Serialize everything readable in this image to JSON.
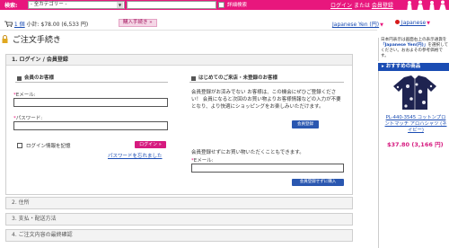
{
  "header": {
    "search_label": "検索:",
    "category_select": "- 全カテゴリー -",
    "advanced_search": "詳細検索",
    "login": "ログイン",
    "or": "または",
    "register": "会員登録"
  },
  "cart": {
    "count": "1 個",
    "subtotal": "小計: $78.00 (6,533 円)",
    "checkout": "購入手続き"
  },
  "locale": {
    "currency": "Japanese Yen (円)",
    "language": "Japanese"
  },
  "page": {
    "title": "ご注文手続き"
  },
  "step1": {
    "title": "1. ログイン / 会員登録",
    "members_heading": "会員のお客様",
    "email_label": "Eメール:",
    "password_label": "パスワード:",
    "remember_label": "ログイン情報を記憶",
    "login_button": "ログイン »",
    "forgot_link": "パスワードを忘れました",
    "new_heading": "はじめてのご来店・未登録のお客様",
    "new_text": "会員登録がお済みでない お客様は、この機会にぜひご登録ください！ 会員になると次回のお買い物よりお客様情報などの入力が不要となり、より快適にショッピングをお楽しみいただけます。",
    "register_button": "会員登録",
    "guest_text": "会員登録せずにお買い物いただくこともできます。",
    "guest_email_label": "Eメール:",
    "guest_button": "会員登録せずに購入"
  },
  "steps": [
    {
      "label": "2. 住所"
    },
    {
      "label": "3. 支払・配送方法"
    },
    {
      "label": "4. ご注文内容の最終確認"
    }
  ],
  "sidebar": {
    "note_prefix": "日本円表示は画面右上の表示通貨を",
    "note_highlight": "「Japanese Yen(円)」",
    "note_suffix": "を選択してください。おおよその参考価格です。",
    "heading": "おすすめの商品",
    "product_name": "PL-440-3545 コットンプロントマッチ アロハシャツ (ネイビー)",
    "product_price": "$37.80 (3,166 円)"
  },
  "colors": {
    "brand_pink": "#e8177d",
    "link_blue": "#1a4cb3",
    "button_blue": "#2a57b0"
  }
}
